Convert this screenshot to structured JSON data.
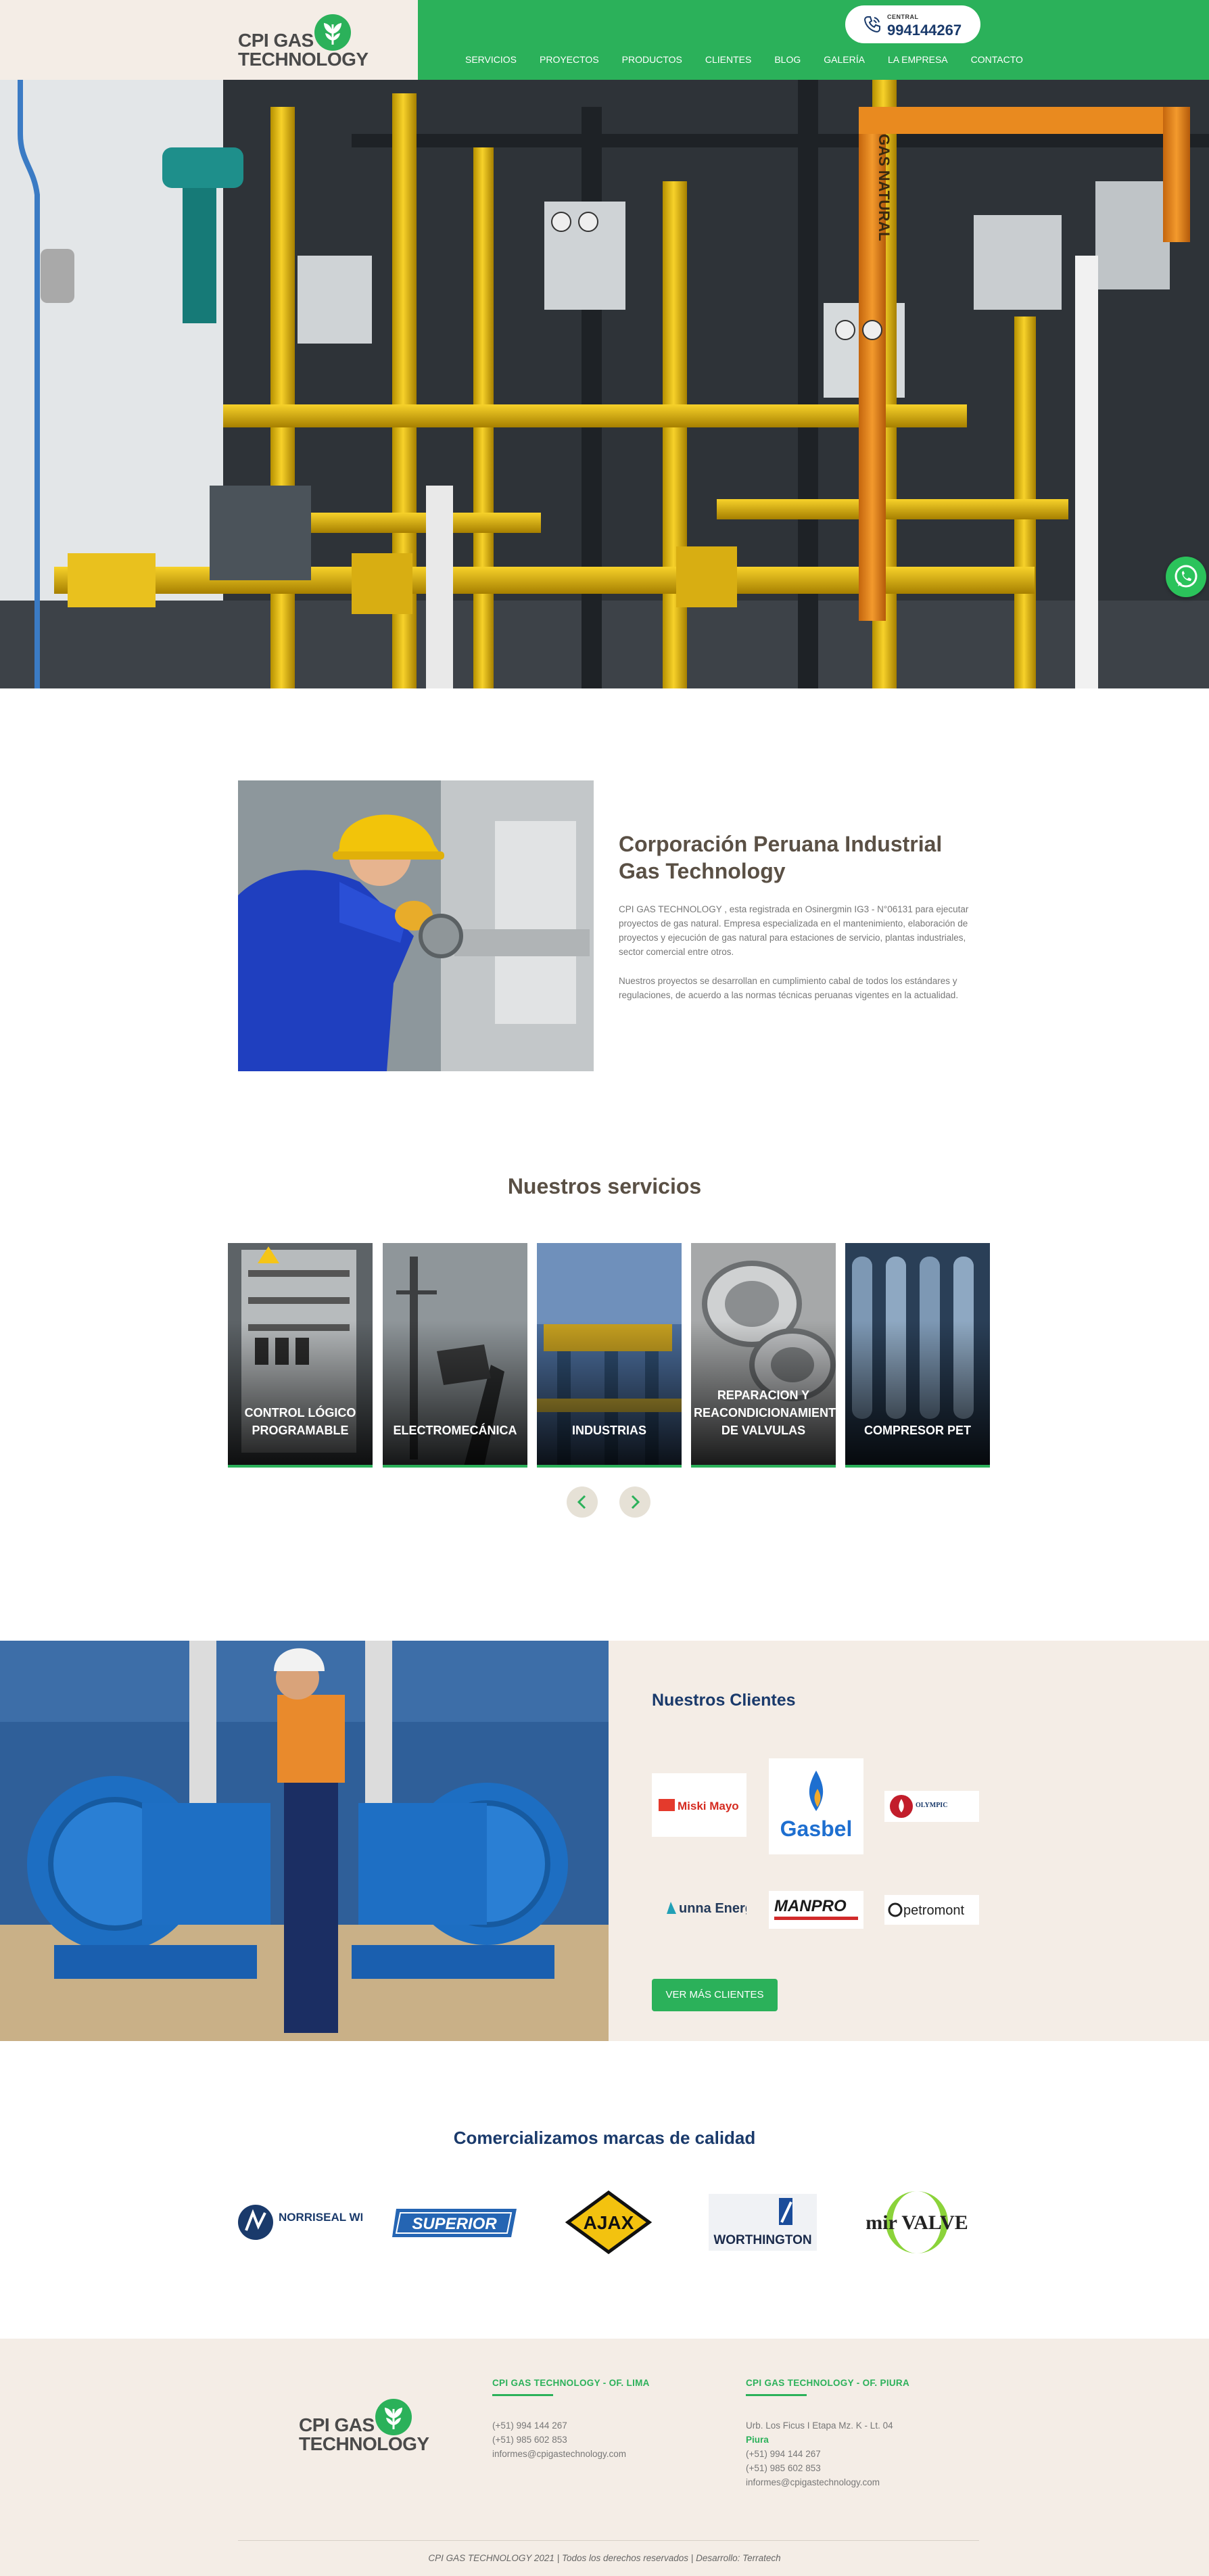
{
  "header": {
    "logo_text_line1": "CPI GAS",
    "logo_text_line2": "TECHNOLOGY",
    "phone_label": "CENTRAL",
    "phone_number": "994144267",
    "nav": [
      "SERVICIOS",
      "PROYECTOS",
      "PRODUCTOS",
      "CLIENTES",
      "BLOG",
      "GALERÍA",
      "LA EMPRESA",
      "CONTACTO"
    ]
  },
  "about": {
    "title": "Corporación Peruana Industrial Gas Technology",
    "paragraph1": "CPI GAS TECHNOLOGY , esta registrada en Osinergmin IG3 - N°06131 para ejecutar proyectos de gas natural. Empresa especializada en el mantenimiento, elaboración de proyectos y ejecución de gas natural para estaciones de servicio, plantas industriales, sector comercial entre otros.",
    "paragraph2": "Nuestros proyectos se desarrollan en cumplimiento cabal de todos los estándares y regulaciones, de acuerdo a las normas técnicas peruanas vigentes en la actualidad."
  },
  "services": {
    "title": "Nuestros servicios",
    "items": [
      {
        "label": "CONTROL LÓGICO PROGRAMABLE"
      },
      {
        "label": "ELECTROMECÁNICA"
      },
      {
        "label": "INDUSTRIAS"
      },
      {
        "label": "REPARACION Y REACONDICIONAMIENTO DE VALVULAS"
      },
      {
        "label": "COMPRESOR PET"
      }
    ]
  },
  "clients": {
    "title": "Nuestros Clientes",
    "logos": [
      "Miski Mayo",
      "Gasbel",
      "OLYMPIC",
      "unna Energía",
      "MANPRO",
      "petromont"
    ],
    "button": "VER MÁS CLIENTES"
  },
  "brands": {
    "title": "Comercializamos marcas de calidad",
    "items": [
      "NORRISEAL WELLMARK",
      "SUPERIOR",
      "AJAX",
      "WORTHINGTON",
      "mir VALVE"
    ]
  },
  "footer": {
    "lima": {
      "title": "CPI GAS TECHNOLOGY - OF. LIMA",
      "lines": [
        "(+51) 994 144 267",
        "(+51) 985 602 853",
        "informes@cpigastechnology.com"
      ]
    },
    "piura": {
      "title": "CPI GAS TECHNOLOGY - OF. PIURA",
      "address": "Urb. Los Ficus I Etapa Mz. K - Lt. 04",
      "city": "Piura",
      "lines": [
        "(+51) 994 144 267",
        "(+51) 985 602 853",
        "informes@cpigastechnology.com"
      ]
    },
    "copyright": "CPI GAS TECHNOLOGY 2021 | Todos los derechos reservados | Desarrollo: Terratech"
  },
  "colors": {
    "brand_green": "#2bb15a",
    "navy": "#1a3a6b",
    "beige": "#f4ede6"
  }
}
